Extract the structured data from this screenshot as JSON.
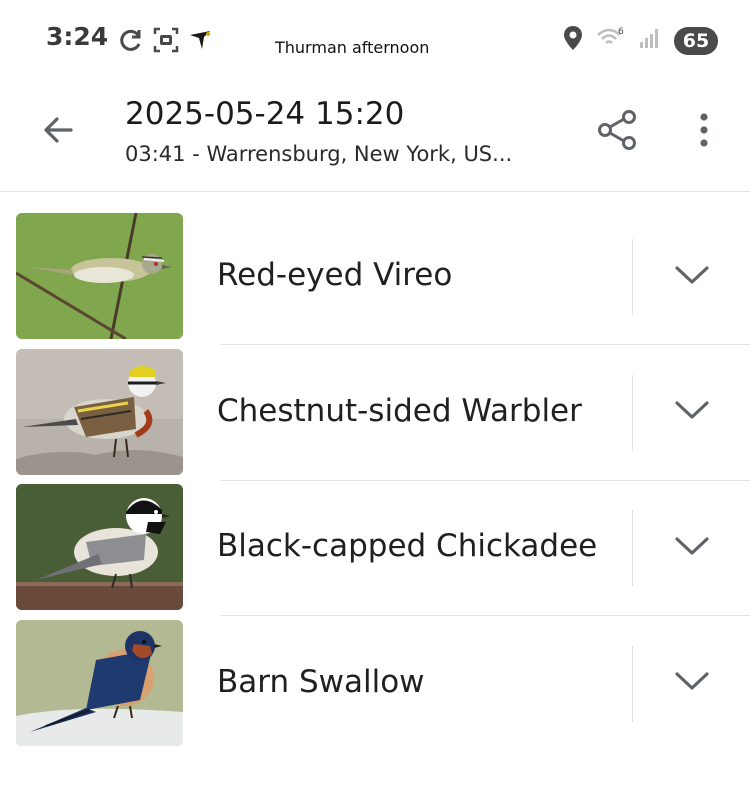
{
  "status_bar": {
    "time": "3:24",
    "note": "Thurman afternoon",
    "battery": "65",
    "icons_left": [
      "sync-icon",
      "screenshot-icon",
      "bird-icon"
    ],
    "icons_right": [
      "location-icon",
      "wifi-icon",
      "signal-icon"
    ]
  },
  "app_bar": {
    "title": "2025-05-24 15:20",
    "subtitle": "03:41 - Warrensburg, New York, US...",
    "back_icon": "arrow-back-icon",
    "share_icon": "share-icon",
    "more_icon": "more-vert-icon"
  },
  "species": [
    {
      "name": "Red-eyed Vireo",
      "image": "red-eyed-vireo-photo",
      "expand_icon": "chevron-down-icon"
    },
    {
      "name": "Chestnut-sided Warbler",
      "image": "chestnut-sided-warbler-photo",
      "expand_icon": "chevron-down-icon"
    },
    {
      "name": "Black-capped Chickadee",
      "image": "black-capped-chickadee-photo",
      "expand_icon": "chevron-down-icon"
    },
    {
      "name": "Barn Swallow",
      "image": "barn-swallow-photo",
      "expand_icon": "chevron-down-icon"
    }
  ],
  "colors": {
    "icon": "#5f6368",
    "text": "#1f1f1f",
    "divider": "#e2e2e2",
    "battery_bg": "#4a4a4a"
  }
}
